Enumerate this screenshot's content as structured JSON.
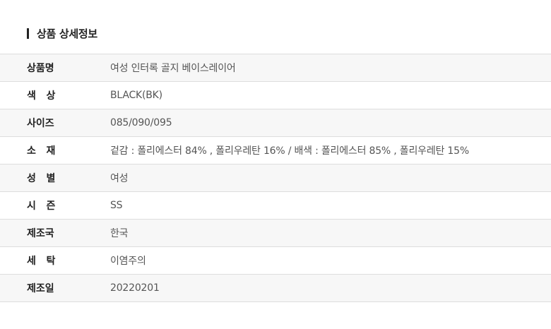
{
  "section": {
    "title": "상품 상세정보"
  },
  "rows": [
    {
      "label": "상품명",
      "value": "여성 인터록 골지 베이스레이어"
    },
    {
      "label": "색   상",
      "value": "BLACK(BK)"
    },
    {
      "label": "사이즈",
      "value": "085/090/095"
    },
    {
      "label": "소   재",
      "value": "겉감 : 폴리에스터 84% , 폴리우레탄 16% / 배색 : 폴리에스터 85% , 폴리우레탄 15%"
    },
    {
      "label": "성   별",
      "value": "여성"
    },
    {
      "label": "시   즌",
      "value": "SS"
    },
    {
      "label": "제조국",
      "value": "한국"
    },
    {
      "label": "세   탁",
      "value": "이염주의"
    },
    {
      "label": "제조일",
      "value": "20220201"
    }
  ]
}
